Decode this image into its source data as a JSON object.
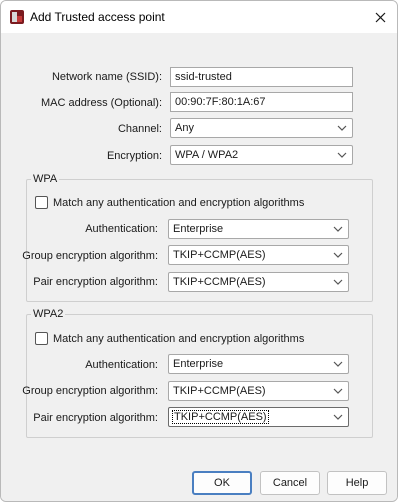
{
  "window": {
    "title": "Add Trusted access point"
  },
  "form": {
    "ssid": {
      "label": "Network name (SSID):",
      "value": "ssid-trusted"
    },
    "mac": {
      "label": "MAC address (Optional):",
      "value": "00:90:7F:80:1A:67"
    },
    "channel": {
      "label": "Channel:",
      "value": "Any"
    },
    "encryption": {
      "label": "Encryption:",
      "value": "WPA / WPA2"
    }
  },
  "wpa": {
    "legend": "WPA",
    "match_label": "Match any authentication and encryption algorithms",
    "auth": {
      "label": "Authentication:",
      "value": "Enterprise"
    },
    "group": {
      "label": "Group encryption algorithm:",
      "value": "TKIP+CCMP(AES)"
    },
    "pair": {
      "label": "Pair encryption algorithm:",
      "value": "TKIP+CCMP(AES)"
    }
  },
  "wpa2": {
    "legend": "WPA2",
    "match_label": "Match any authentication and encryption algorithms",
    "auth": {
      "label": "Authentication:",
      "value": "Enterprise"
    },
    "group": {
      "label": "Group encryption algorithm:",
      "value": "TKIP+CCMP(AES)"
    },
    "pair": {
      "label": "Pair encryption algorithm:",
      "value": "TKIP+CCMP(AES)"
    }
  },
  "buttons": {
    "ok": "OK",
    "cancel": "Cancel",
    "help": "Help"
  },
  "icons": {
    "app": "app-logo-icon",
    "close": "close-icon",
    "dropdown": "chevron-down-icon"
  },
  "colors": {
    "default_button_border": "#4a7fc1",
    "background": "#f0f0f0"
  }
}
